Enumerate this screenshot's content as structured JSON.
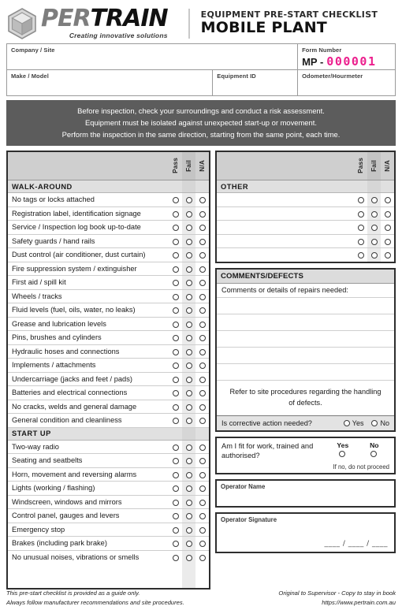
{
  "brand": {
    "logo_icon": "cube-icon",
    "name_part1": "PER",
    "name_part2": "TRAIN",
    "tagline": "Creating innovative solutions"
  },
  "header": {
    "subtitle": "EQUIPMENT PRE-START CHECKLIST",
    "title": "MOBILE PLANT"
  },
  "info": {
    "company_label": "Company / Site",
    "company_value": "",
    "make_label": "Make / Model",
    "make_value": "",
    "equipment_label": "Equipment ID",
    "equipment_value": "",
    "form_label": "Form Number",
    "form_prefix": "MP -",
    "form_digits": "000001",
    "odometer_label": "Odometer/Hourmeter",
    "odometer_value": ""
  },
  "banner": {
    "line1": "Before inspection, check your surroundings and conduct a risk assessment.",
    "line2": "Equipment must be isolated against unexpected start-up or movement.",
    "line3": "Perform the inspection in the same direction, starting from the same point, each time."
  },
  "columns": {
    "pass": "Pass",
    "fail": "Fail",
    "na": "N/A"
  },
  "checklist": {
    "sections": [
      {
        "title": "WALK-AROUND",
        "items": [
          "No tags or locks attached",
          "Registration label, identification signage",
          "Service / Inspection log book up-to-date",
          "Safety guards / hand rails",
          "Dust control (air conditioner, dust curtain)",
          "Fire suppression system / extinguisher",
          "First aid / spill kit",
          "Wheels / tracks",
          "Fluid levels (fuel, oils, water, no leaks)",
          "Grease and lubrication levels",
          "Pins, brushes and cylinders",
          "Hydraulic hoses and connections",
          "Implements / attachments",
          "Undercarriage (jacks and feet / pads)",
          "Batteries and electrical connections",
          "No cracks, welds and general damage",
          "General condition and cleanliness"
        ]
      },
      {
        "title": "START UP",
        "items": [
          "Two-way radio",
          "Seating and seatbelts",
          "Horn, movement and reversing alarms",
          "Lights (working / flashing)",
          "Windscreen, windows and mirrors",
          "Control panel, gauges and levers",
          "Emergency stop",
          "Brakes (including park brake)",
          "No unusual noises, vibrations or smells"
        ]
      }
    ]
  },
  "other": {
    "title": "OTHER",
    "rows": [
      "",
      "",
      "",
      "",
      ""
    ]
  },
  "comments": {
    "title": "COMMENTS/DEFECTS",
    "prompt": "Comments or details of repairs needed:",
    "blank_lines": 5,
    "note": "Refer to site procedures regarding the handling of defects.",
    "action_question": "Is corrective action needed?",
    "yes": "Yes",
    "no": "No"
  },
  "fitness": {
    "question": "Am I fit for work, trained and authorised?",
    "yes": "Yes",
    "no": "No",
    "footnote": "If no, do not proceed"
  },
  "operator": {
    "name_label": "Operator Name",
    "name_value": "",
    "signature_label": "Operator Signature",
    "signature_value": "",
    "date_line": "____ / ____ / ____"
  },
  "footer": {
    "left_line1": "This pre-start checklist is provided as a guide only.",
    "left_line2": "Always follow manufacturer recommendations and site procedures.",
    "right_line1": "Original to Supervisor - Copy to stay in book",
    "right_line2": "https://www.pertrain.com.au"
  },
  "colors": {
    "accent_pink": "#ec1f8d",
    "banner_gray": "#5c5c5c",
    "header_gray": "#cfcfcf",
    "section_gray": "#e0e0e0"
  }
}
